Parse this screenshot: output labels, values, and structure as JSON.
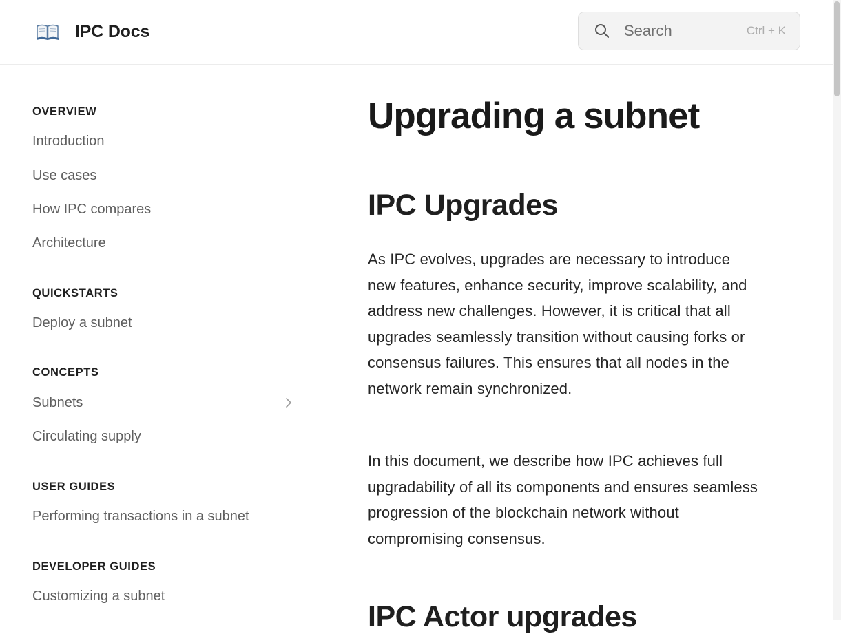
{
  "header": {
    "brand_title": "IPC Docs",
    "brand_icon": "open-book-icon",
    "search": {
      "placeholder": "Search",
      "shortcut": "Ctrl + K",
      "icon": "search-icon"
    }
  },
  "sidebar": {
    "sections": [
      {
        "title": "OVERVIEW",
        "items": [
          {
            "label": "Introduction"
          },
          {
            "label": "Use cases"
          },
          {
            "label": "How IPC compares"
          },
          {
            "label": "Architecture"
          }
        ]
      },
      {
        "title": "QUICKSTARTS",
        "items": [
          {
            "label": "Deploy a subnet"
          }
        ]
      },
      {
        "title": "CONCEPTS",
        "items": [
          {
            "label": "Subnets",
            "expandable": true,
            "icon": "chevron-right-icon"
          },
          {
            "label": "Circulating supply"
          }
        ]
      },
      {
        "title": "USER GUIDES",
        "items": [
          {
            "label": "Performing transactions in a subnet"
          }
        ]
      },
      {
        "title": "DEVELOPER GUIDES",
        "items": [
          {
            "label": "Customizing a subnet"
          }
        ]
      }
    ]
  },
  "main": {
    "page_title": "Upgrading a subnet",
    "section_heading": "IPC Upgrades",
    "paragraphs": [
      "As IPC evolves, upgrades are necessary to introduce new features, enhance security, improve scalability, and address new challenges. However, it is critical that all upgrades seamlessly transition without causing forks or consensus failures. This ensures that all nodes in the network remain synchronized.",
      "In this document, we describe how IPC achieves full upgradability of all its components and ensures seamless progression of the blockchain network without compromising consensus."
    ],
    "next_heading": "IPC Actor upgrades"
  },
  "colors": {
    "background": "#ffffff",
    "text": "#242424",
    "nav_text": "#5f5f5f",
    "search_bg": "#f3f3f3",
    "border": "#ececec"
  }
}
